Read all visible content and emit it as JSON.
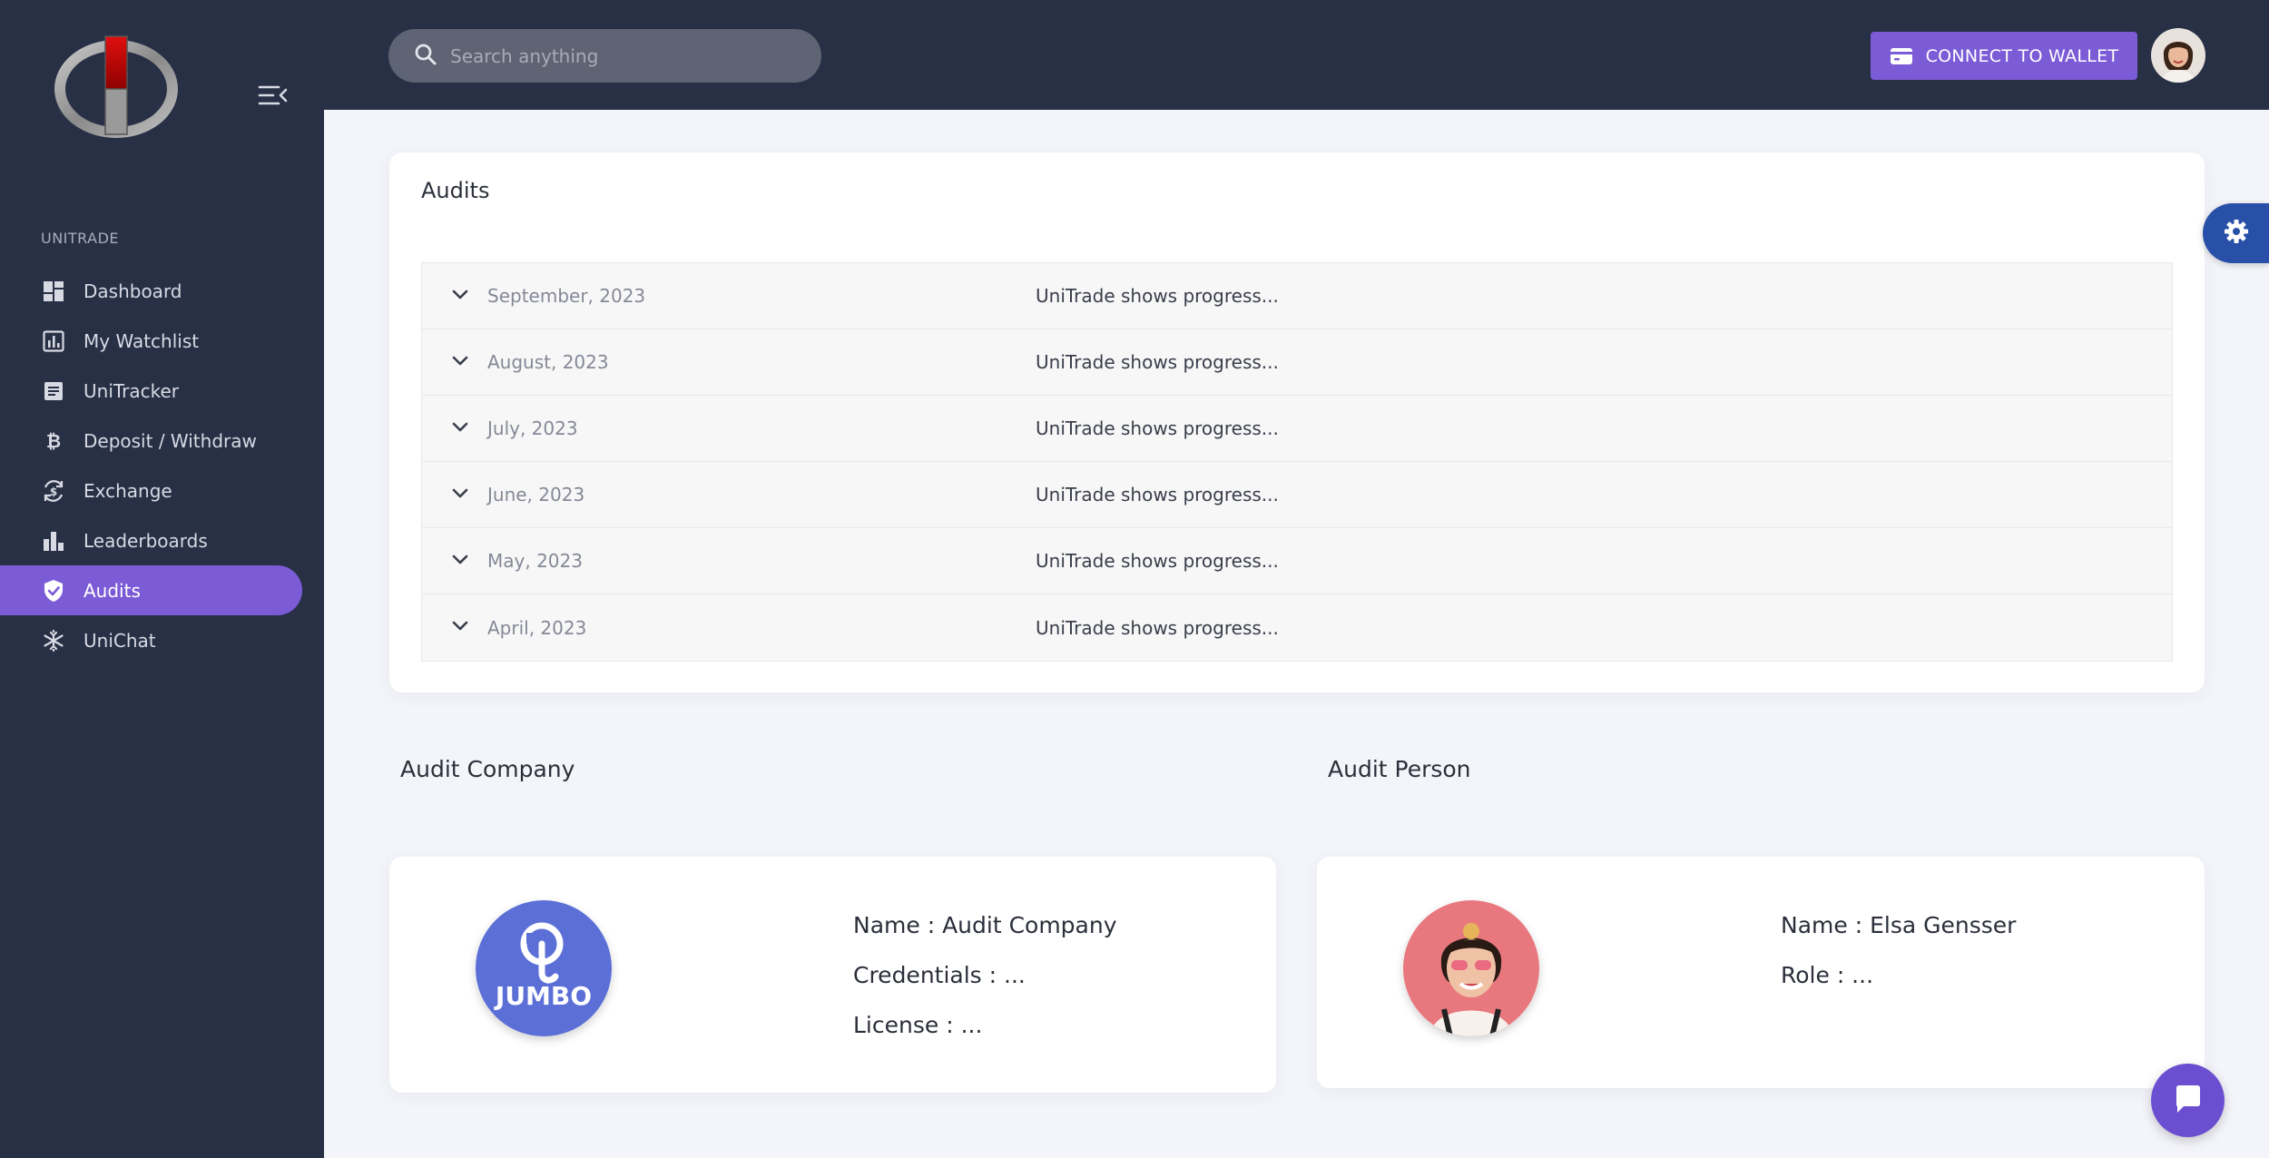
{
  "sidebar": {
    "section_label": "UNITRADE",
    "items": [
      {
        "label": "Dashboard",
        "icon": "dashboard-icon"
      },
      {
        "label": "My Watchlist",
        "icon": "chart-icon"
      },
      {
        "label": "UniTracker",
        "icon": "document-icon"
      },
      {
        "label": "Deposit / Withdraw",
        "icon": "bitcoin-icon"
      },
      {
        "label": "Exchange",
        "icon": "exchange-icon"
      },
      {
        "label": "Leaderboards",
        "icon": "leaderboard-icon"
      },
      {
        "label": "Audits",
        "icon": "shield-check-icon"
      },
      {
        "label": "UniChat",
        "icon": "snowflake-icon"
      }
    ],
    "active_item": "Audits"
  },
  "header": {
    "search_placeholder": "Search anything",
    "connect_label": "CONNECT TO WALLET"
  },
  "audits": {
    "title": "Audits",
    "rows": [
      {
        "date": "September, 2023",
        "summary": "UniTrade shows progress..."
      },
      {
        "date": "August, 2023",
        "summary": "UniTrade shows progress..."
      },
      {
        "date": "July, 2023",
        "summary": "UniTrade shows progress..."
      },
      {
        "date": "June, 2023",
        "summary": "UniTrade shows progress..."
      },
      {
        "date": "May, 2023",
        "summary": "UniTrade shows progress..."
      },
      {
        "date": "April, 2023",
        "summary": "UniTrade shows progress..."
      }
    ]
  },
  "audit_company": {
    "heading": "Audit Company",
    "logo_text": "JUMBO",
    "name": "Name : Audit Company",
    "credentials": "Credentials : ...",
    "license": "License : ..."
  },
  "audit_person": {
    "heading": "Audit Person",
    "name": "Name : Elsa Gensser",
    "role": "Role : ..."
  },
  "colors": {
    "sidebar_bg": "#283046",
    "accent": "#7b5bd6",
    "page_bg": "#f4f5fa",
    "settings_fab": "#2950a8"
  }
}
